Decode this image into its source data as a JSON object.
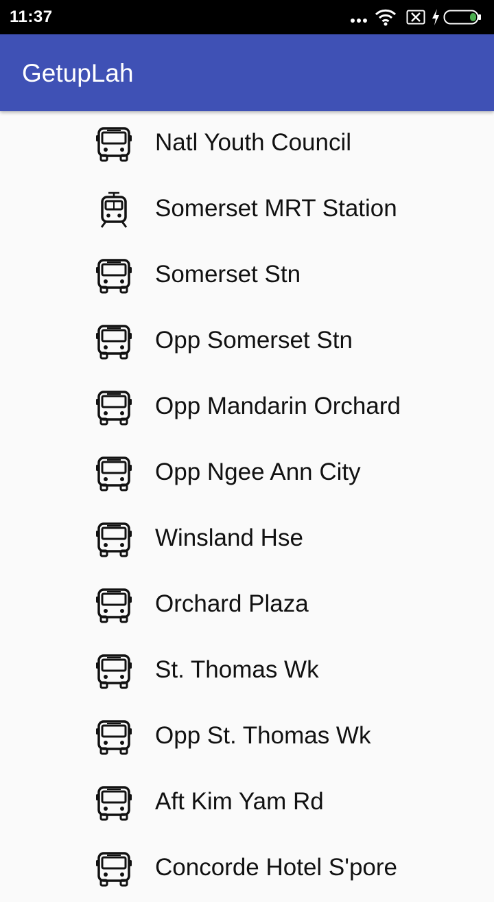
{
  "status_bar": {
    "time": "11:37"
  },
  "app_bar": {
    "title": "GetupLah"
  },
  "stops": [
    {
      "label": "Natl Youth Council",
      "icon": "bus-icon"
    },
    {
      "label": "Somerset MRT Station",
      "icon": "train-icon"
    },
    {
      "label": "Somerset Stn",
      "icon": "bus-icon"
    },
    {
      "label": "Opp Somerset Stn",
      "icon": "bus-icon"
    },
    {
      "label": "Opp Mandarin Orchard",
      "icon": "bus-icon"
    },
    {
      "label": "Opp Ngee Ann City",
      "icon": "bus-icon"
    },
    {
      "label": "Winsland Hse",
      "icon": "bus-icon"
    },
    {
      "label": "Orchard Plaza",
      "icon": "bus-icon"
    },
    {
      "label": "St. Thomas Wk",
      "icon": "bus-icon"
    },
    {
      "label": "Opp St. Thomas Wk",
      "icon": "bus-icon"
    },
    {
      "label": "Aft Kim Yam Rd",
      "icon": "bus-icon"
    },
    {
      "label": "Concorde Hotel S'pore",
      "icon": "bus-icon"
    }
  ],
  "colors": {
    "app_bar": "#3f51b5",
    "battery_accent": "#4caf50"
  }
}
